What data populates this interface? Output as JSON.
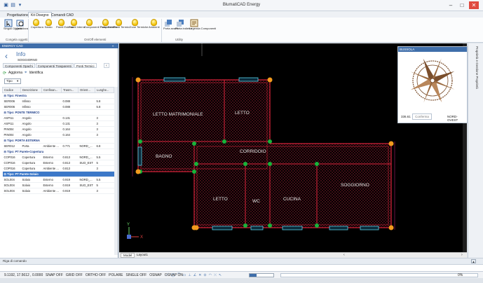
{
  "app": {
    "title": "BlumatiCAD Energy"
  },
  "window_controls": {
    "minimize": "–",
    "maximize": "□",
    "close": "✕"
  },
  "tabs": [
    "Progettazione",
    "Kit Disegno",
    "Comandi CAD"
  ],
  "ribbon": {
    "buttons": [
      {
        "label": "Singoli Oggetti",
        "icon": "select-icon"
      },
      {
        "label": "Visualizza",
        "icon": "view-icon"
      },
      {
        "label": "Copertura",
        "icon": "bulb-icon"
      },
      {
        "label": "Solaio",
        "icon": "bulb-icon"
      },
      {
        "label": "Pareti Esterne",
        "icon": "bulb-icon"
      },
      {
        "label": "Pareti Interne",
        "icon": "bulb-icon"
      },
      {
        "label": "Componenti Trasparenti",
        "icon": "bulb-icon"
      },
      {
        "label": "Porte Esterne",
        "icon": "bulb-icon"
      },
      {
        "label": "Ponti Termici",
        "icon": "bulb-icon"
      },
      {
        "label": "Zone Termiche",
        "icon": "bulb-icon"
      },
      {
        "label": "Ambienti",
        "icon": "bulb-icon"
      },
      {
        "label": "Porta avanti",
        "icon": "bring-forward-icon"
      },
      {
        "label": "Porta indietro",
        "icon": "send-backward-icon"
      },
      {
        "label": "Legenda Componenti",
        "icon": "legend-icon"
      }
    ],
    "groups": [
      "Congela oggetti",
      "On/Off elementi",
      "Utility"
    ]
  },
  "left_panel": {
    "header": "ENERGY CAD",
    "info_title": "Info",
    "info_subtitle": "SOGGIORNO",
    "subtabs": [
      "Componenti Opachi",
      "Componenti Trasparenti",
      "Ponti Termici"
    ],
    "refresh_label": "Aggiorna",
    "identify_label": "Identifica",
    "filter_value": "Tipo",
    "columns": [
      "Codice",
      "Descrizione",
      "Confinan...",
      "Trasm...",
      "Orient...",
      "Lunghe..."
    ],
    "rows": [
      {
        "group": "Tipo: Finestra"
      },
      {
        "cells": [
          "SER006",
          "Infisso",
          "",
          "0.088",
          "",
          "5.8"
        ]
      },
      {
        "cells": [
          "SER006",
          "Infisso",
          "",
          "0.088",
          "",
          "5.8"
        ]
      },
      {
        "group": "Tipo: PONTE TERMICO"
      },
      {
        "cells": [
          "ASPI11",
          "Angolo",
          "",
          "0.131",
          "",
          "3"
        ]
      },
      {
        "cells": [
          "ASPI11",
          "Angolo",
          "",
          "0.131",
          "",
          "3"
        ]
      },
      {
        "cells": [
          "PIN004",
          "Angolo",
          "",
          "0.164",
          "",
          "3"
        ]
      },
      {
        "cells": [
          "PIN004",
          "Angolo",
          "",
          "0.164",
          "",
          "3"
        ]
      },
      {
        "group": "Tipo: PORTA ESTERNA"
      },
      {
        "cells": [
          "SER012",
          "Porta",
          "Ambiente ...",
          "0.771",
          "NORD_...",
          "6.8"
        ]
      },
      {
        "group": "Tipo: PT Parete-Copertura"
      },
      {
        "cells": [
          "COP016",
          "Copertura",
          "Esterno",
          "0.813",
          "NORD_...",
          "5.5"
        ]
      },
      {
        "cells": [
          "COP016",
          "Copertura",
          "Esterno",
          "0.813",
          "SUD_EST",
          "5"
        ]
      },
      {
        "cells": [
          "COP016",
          "Copertura",
          "Ambiente ...",
          "0.813",
          "",
          "3"
        ]
      },
      {
        "group": "Tipo: PT Parete-Solaio",
        "selected": true
      },
      {
        "cells": [
          "SOL004",
          "Solaio",
          "Esterno",
          "0.919",
          "NORD_...",
          "5.5"
        ]
      },
      {
        "cells": [
          "SOL004",
          "Solaio",
          "Esterno",
          "0.919",
          "SUD_EST",
          "5"
        ]
      },
      {
        "cells": [
          "SOL004",
          "Solaio",
          "Ambiente ...",
          "0.919",
          "",
          "3"
        ]
      }
    ]
  },
  "rooms": [
    {
      "name": "LETTO MATRIMONIALE"
    },
    {
      "name": "LETTO"
    },
    {
      "name": "BAGNO"
    },
    {
      "name": "CORRIDOIO"
    },
    {
      "name": "LETTO"
    },
    {
      "name": "WC"
    },
    {
      "name": "CUCINA"
    },
    {
      "name": "SOGGIORNO"
    }
  ],
  "compass": {
    "title": "BUSSOLA",
    "angle_value": "336.61",
    "confirm_label": "Conferma",
    "orientation": "NORD-OVEST"
  },
  "right_strip_label": "Proprietà e Gestione Proprietà",
  "cad_tabs": [
    "Model",
    "Layout1"
  ],
  "command_bar_label": "Riga di comando",
  "status": {
    "coords": "9.1192, 17.5612 , 0.0000",
    "toggles": [
      "SNAP OFF",
      "GRID OFF",
      "ORTHO OFF",
      "POLARE",
      "SINGLE OFF",
      "OSNAP",
      "OSNAP ON"
    ],
    "zoom": "0%"
  },
  "colors": {
    "accent": "#3f6eaa",
    "wall": "#d8233a",
    "door_dot": "#f29a1d",
    "window": "#5ad0e8",
    "thermal_bridge": "#17b33a"
  }
}
